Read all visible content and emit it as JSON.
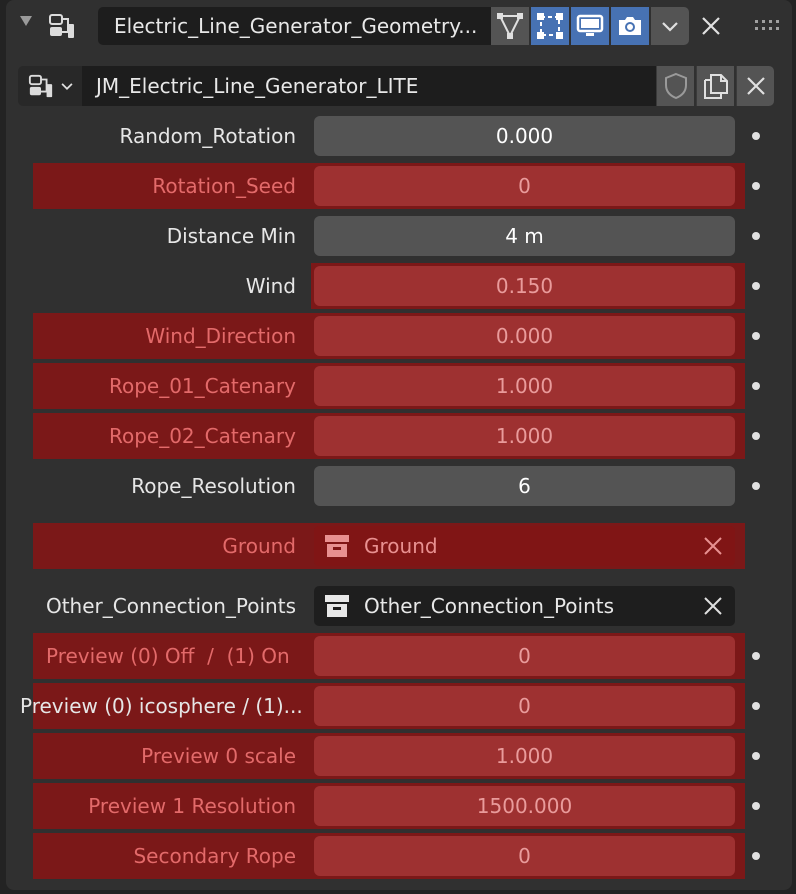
{
  "header": {
    "modifier_name": "Electric_Line_Generator_Geometry...",
    "icons": [
      "expand-triangle-icon",
      "geometry-nodes-modifier-icon",
      "edit-mode-icon",
      "on-cage-icon",
      "viewport-icon",
      "render-icon",
      "chevron-down-icon",
      "close-icon",
      "drag-grip-icon"
    ]
  },
  "node_group": {
    "name": "JM_Electric_Line_Generator_LITE",
    "icons": [
      "node-tree-icon",
      "chevron-down-icon",
      "fake-user-shield-icon",
      "duplicate-icon",
      "close-icon"
    ]
  },
  "properties": [
    {
      "label": "Random_Rotation",
      "value": "0.000",
      "animated": false
    },
    {
      "label": "Rotation_Seed",
      "value": "0",
      "animated": true
    },
    {
      "label": "Distance Min",
      "value": "4 m",
      "animated": false
    },
    {
      "label": "Wind",
      "value": "0.150",
      "animated": true
    },
    {
      "label": "Wind_Direction",
      "value": "0.000",
      "animated": true
    },
    {
      "label": "Rope_01_Catenary",
      "value": "1.000",
      "animated": true
    },
    {
      "label": "Rope_02_Catenary",
      "value": "1.000",
      "animated": true
    },
    {
      "label": "Rope_Resolution",
      "value": "6",
      "animated": false
    }
  ],
  "object_fields": [
    {
      "label": "Ground",
      "value": "Ground",
      "animated": true
    },
    {
      "label": "Other_Connection_Points",
      "value": "Other_Connection_Points",
      "animated": false
    }
  ],
  "properties2": [
    {
      "label": "Preview (0) Off  /  (1) On",
      "value": "0",
      "animated": true
    },
    {
      "label": "Preview (0) icosphere / (1)...",
      "value": "0",
      "animated": true
    },
    {
      "label": "Preview 0 scale",
      "value": "1.000",
      "animated": true
    },
    {
      "label": "Preview 1 Resolution",
      "value": "1500.000",
      "animated": true
    },
    {
      "label": "Secondary Rope",
      "value": "0",
      "animated": true
    }
  ],
  "colors": {
    "panel_bg": "#303030",
    "animated_band": "#7b1818",
    "animated_field": "#9e3131",
    "animated_text": "#e36a6a",
    "field_bg": "#545454",
    "toggle_active": "#4772b3"
  }
}
